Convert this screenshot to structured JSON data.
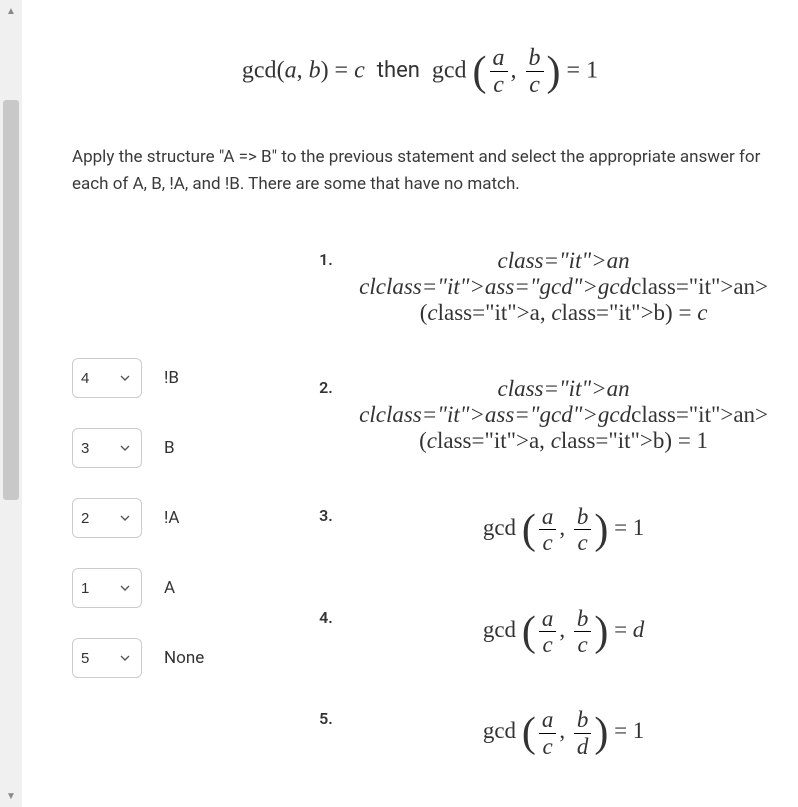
{
  "main_equation": {
    "lhs": "gcd(a, b) = c",
    "connector": "then",
    "rhs_prefix": "gcd",
    "frac1_num": "a",
    "frac1_den": "c",
    "frac2_num": "b",
    "frac2_den": "c",
    "rhs_eq": "= 1"
  },
  "instruction": "Apply the structure \"A => B\" to the previous statement and select the appropriate answer for each of A, B, !A, and !B. There are some that have no match.",
  "selectors": [
    {
      "value": "4",
      "label": "!B"
    },
    {
      "value": "3",
      "label": "B"
    },
    {
      "value": "2",
      "label": "!A"
    },
    {
      "value": "1",
      "label": "A"
    },
    {
      "value": "5",
      "label": "None"
    }
  ],
  "select_options": [
    "1",
    "2",
    "3",
    "4",
    "5"
  ],
  "options": [
    {
      "num": "1.",
      "type": "simple",
      "text": "gcd(a, b) = c"
    },
    {
      "num": "2.",
      "type": "simple",
      "text": "gcd(a, b) = 1"
    },
    {
      "num": "3.",
      "type": "frac",
      "prefix": "gcd",
      "n1": "a",
      "d1": "c",
      "n2": "b",
      "d2": "c",
      "eq": "= 1"
    },
    {
      "num": "4.",
      "type": "frac",
      "prefix": "gcd",
      "n1": "a",
      "d1": "c",
      "n2": "b",
      "d2": "c",
      "eq": "= d"
    },
    {
      "num": "5.",
      "type": "frac",
      "prefix": "gcd",
      "n1": "a",
      "d1": "c",
      "n2": "b",
      "d2": "d",
      "eq": "= 1"
    }
  ]
}
